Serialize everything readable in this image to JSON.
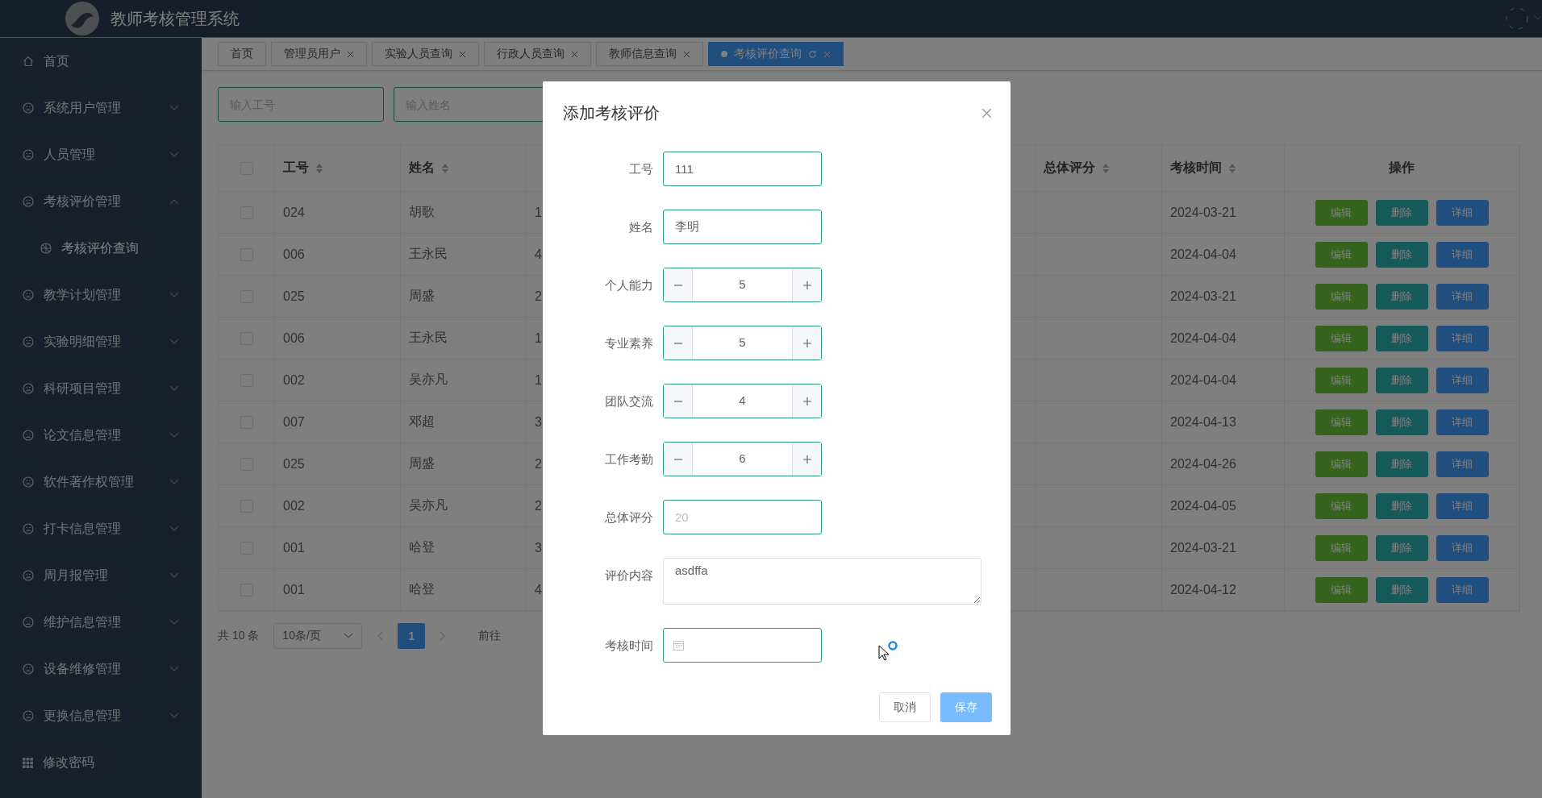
{
  "header": {
    "title": "教师考核管理系统"
  },
  "sidebar": {
    "items": [
      {
        "label": "首页",
        "kind": "home"
      },
      {
        "label": "系统用户管理",
        "kind": "group",
        "expanded": false
      },
      {
        "label": "人员管理",
        "kind": "group",
        "expanded": false
      },
      {
        "label": "考核评价管理",
        "kind": "group",
        "expanded": true,
        "children": [
          {
            "label": "考核评价查询"
          }
        ]
      },
      {
        "label": "教学计划管理",
        "kind": "group",
        "expanded": false
      },
      {
        "label": "实验明细管理",
        "kind": "group",
        "expanded": false
      },
      {
        "label": "科研项目管理",
        "kind": "group",
        "expanded": false
      },
      {
        "label": "论文信息管理",
        "kind": "group",
        "expanded": false
      },
      {
        "label": "软件著作权管理",
        "kind": "group",
        "expanded": false
      },
      {
        "label": "打卡信息管理",
        "kind": "group",
        "expanded": false
      },
      {
        "label": "周月报管理",
        "kind": "group",
        "expanded": false
      },
      {
        "label": "维护信息管理",
        "kind": "group",
        "expanded": false
      },
      {
        "label": "设备维修管理",
        "kind": "group",
        "expanded": false
      },
      {
        "label": "更换信息管理",
        "kind": "group",
        "expanded": false
      },
      {
        "label": "修改密码",
        "kind": "grid"
      }
    ]
  },
  "tabs": [
    {
      "label": "首页",
      "selected": false,
      "closable": false
    },
    {
      "label": "管理员用户",
      "selected": false,
      "closable": true
    },
    {
      "label": "实验人员查询",
      "selected": false,
      "closable": true
    },
    {
      "label": "行政人员查询",
      "selected": false,
      "closable": true
    },
    {
      "label": "教师信息查询",
      "selected": false,
      "closable": true
    },
    {
      "label": "考核评价查询",
      "selected": true,
      "closable": true
    }
  ],
  "search": [
    {
      "placeholder": "输入工号"
    },
    {
      "placeholder": "输入姓名"
    }
  ],
  "table": {
    "select_all": {
      "checked": false
    },
    "columns": [
      {
        "label": "工号",
        "sortable": true
      },
      {
        "label": "姓名",
        "sortable": true
      },
      {
        "label": "总体评分",
        "sortable": true
      },
      {
        "label": "考核时间",
        "sortable": true
      },
      {
        "label": "操作",
        "sortable": false
      }
    ],
    "rows": [
      {
        "checked": false,
        "id": "024",
        "name": "胡歌",
        "column_3": "1",
        "date": "2024-03-21",
        "actions": [
          {
            "label": "编辑",
            "kind": "edit"
          },
          {
            "label": "删除",
            "kind": "delete"
          },
          {
            "label": "详细",
            "kind": "detail"
          }
        ]
      },
      {
        "checked": false,
        "id": "006",
        "name": "王永民",
        "column_3": "4",
        "date": "2024-04-04",
        "actions": [
          {
            "label": "编辑",
            "kind": "edit"
          },
          {
            "label": "删除",
            "kind": "delete"
          },
          {
            "label": "详细",
            "kind": "detail"
          }
        ]
      },
      {
        "checked": false,
        "id": "025",
        "name": "周盛",
        "column_3": "2",
        "date": "2024-03-21",
        "actions": [
          {
            "label": "编辑",
            "kind": "edit"
          },
          {
            "label": "删除",
            "kind": "delete"
          },
          {
            "label": "详细",
            "kind": "detail"
          }
        ]
      },
      {
        "checked": false,
        "id": "006",
        "name": "王永民",
        "column_3": "1",
        "date": "2024-04-04",
        "actions": [
          {
            "label": "编辑",
            "kind": "edit"
          },
          {
            "label": "删除",
            "kind": "delete"
          },
          {
            "label": "详细",
            "kind": "detail"
          }
        ]
      },
      {
        "checked": false,
        "id": "002",
        "name": "吴亦凡",
        "column_3": "1",
        "date": "2024-04-04",
        "actions": [
          {
            "label": "编辑",
            "kind": "edit"
          },
          {
            "label": "删除",
            "kind": "delete"
          },
          {
            "label": "详细",
            "kind": "detail"
          }
        ]
      },
      {
        "checked": false,
        "id": "007",
        "name": "邓超",
        "column_3": "3",
        "date": "2024-04-13",
        "actions": [
          {
            "label": "编辑",
            "kind": "edit"
          },
          {
            "label": "删除",
            "kind": "delete"
          },
          {
            "label": "详细",
            "kind": "detail"
          }
        ]
      },
      {
        "checked": false,
        "id": "025",
        "name": "周盛",
        "column_3": "2",
        "date": "2024-04-26",
        "actions": [
          {
            "label": "编辑",
            "kind": "edit"
          },
          {
            "label": "删除",
            "kind": "delete"
          },
          {
            "label": "详细",
            "kind": "detail"
          }
        ]
      },
      {
        "checked": false,
        "id": "002",
        "name": "吴亦凡",
        "column_3": "2",
        "date": "2024-04-05",
        "actions": [
          {
            "label": "编辑",
            "kind": "edit"
          },
          {
            "label": "删除",
            "kind": "delete"
          },
          {
            "label": "详细",
            "kind": "detail"
          }
        ]
      },
      {
        "checked": false,
        "id": "001",
        "name": "哈登",
        "column_3": "3",
        "date": "2024-03-21",
        "actions": [
          {
            "label": "编辑",
            "kind": "edit"
          },
          {
            "label": "删除",
            "kind": "delete"
          },
          {
            "label": "详细",
            "kind": "detail"
          }
        ]
      },
      {
        "checked": false,
        "id": "001",
        "name": "哈登",
        "column_3": "4",
        "date": "2024-04-12",
        "actions": [
          {
            "label": "编辑",
            "kind": "edit"
          },
          {
            "label": "删除",
            "kind": "delete"
          },
          {
            "label": "详细",
            "kind": "detail"
          }
        ]
      }
    ]
  },
  "pagination": {
    "total": "共 10 条",
    "page_size": "10条/页",
    "pages": [
      {
        "label": "1",
        "selected": true
      }
    ],
    "goto": "前往"
  },
  "dialog": {
    "title": "添加考核评价",
    "fields": [
      {
        "label": "工号",
        "kind": "text",
        "value": "111"
      },
      {
        "label": "姓名",
        "kind": "text",
        "value": "李明"
      },
      {
        "label": "个人能力",
        "kind": "number",
        "value": "5"
      },
      {
        "label": "专业素养",
        "kind": "number",
        "value": "5"
      },
      {
        "label": "团队交流",
        "kind": "number",
        "value": "4"
      },
      {
        "label": "工作考勤",
        "kind": "number",
        "value": "6"
      },
      {
        "label": "总体评分",
        "kind": "text",
        "placeholder": "20"
      },
      {
        "label": "评价内容",
        "kind": "textarea",
        "value": "asdffa"
      },
      {
        "label": "考核时间",
        "kind": "date"
      }
    ],
    "buttons": [
      {
        "label": "取消",
        "kind": "default"
      },
      {
        "label": "保存",
        "kind": "primary"
      }
    ]
  }
}
